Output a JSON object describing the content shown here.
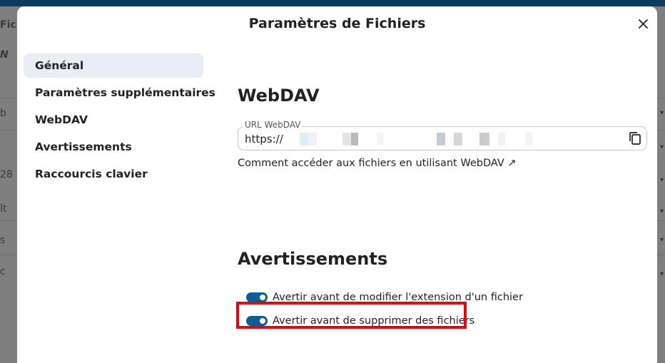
{
  "dialog": {
    "title": "Paramètres de Fichiers",
    "close_icon": "close-icon"
  },
  "nav": {
    "items": [
      {
        "label": "Général",
        "active": true
      },
      {
        "label": "Paramètres supplémentaires"
      },
      {
        "label": "WebDAV"
      },
      {
        "label": "Avertissements"
      },
      {
        "label": "Raccourcis clavier"
      }
    ]
  },
  "webdav": {
    "heading": "WebDAV",
    "url_label": "URL WebDAV",
    "url_value": "https://",
    "copy_icon": "copy-icon",
    "help_link": "Comment accéder aux fichiers en utilisant WebDAV ↗"
  },
  "warnings": {
    "heading": "Avertissements",
    "toggles": [
      {
        "label": "Avertir avant de modifier l'extension d'un fichier",
        "on": true
      },
      {
        "label": "Avertir avant de supprimer des fichiers",
        "on": true
      }
    ]
  },
  "background": {
    "left_fragments": [
      "Fic",
      "N",
      "b",
      "28",
      "lt",
      "s",
      "c"
    ]
  },
  "colors": {
    "accent": "#0b5e93",
    "highlight": "#e8000a",
    "active_nav_bg": "#e8eef5"
  }
}
